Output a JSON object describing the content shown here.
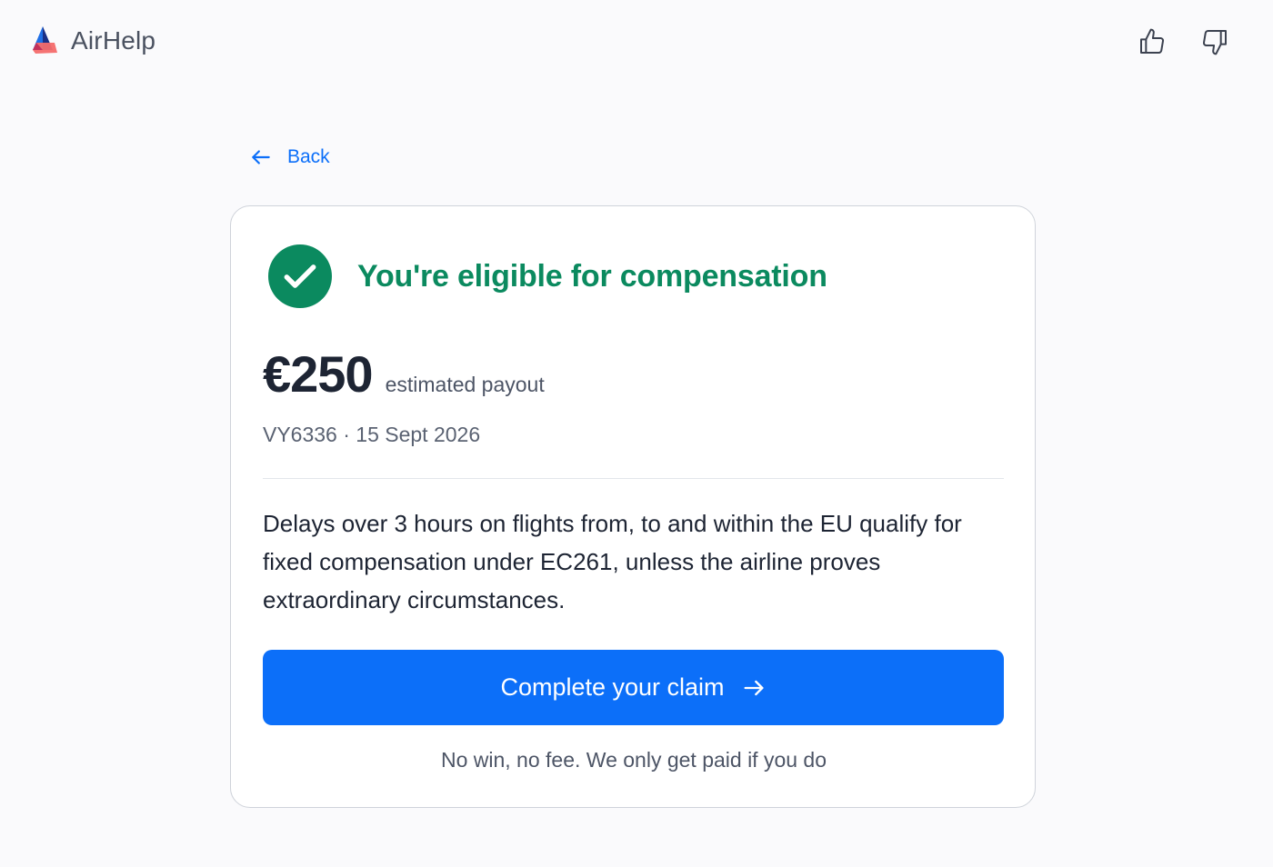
{
  "brand": {
    "name": "AirHelp",
    "logo": "airhelp-logo-icon"
  },
  "feedback": {
    "up_icon": "thumbs-up-icon",
    "down_icon": "thumbs-down-icon"
  },
  "nav": {
    "back_label": "Back",
    "back_icon": "arrow-left-icon"
  },
  "result": {
    "status_icon": "check-circle-icon",
    "title": "You're eligible for compensation",
    "amount": "€250",
    "amount_label": "estimated payout",
    "flight": "VY6336 · 15 Sept 2026",
    "explanation": "Delays over 3 hours on flights from, to and within the EU qualify for fixed compensation under EC261, unless the airline proves extraordinary circumstances.",
    "cta_label": "Complete your claim",
    "cta_icon": "arrow-right-icon",
    "note": "No win, no fee. We only get paid if you do"
  },
  "colors": {
    "accent": "#0c6ff9",
    "success": "#0b8a5f",
    "text": "#1d2433",
    "muted": "#4d5566",
    "background": "#fafafc"
  }
}
